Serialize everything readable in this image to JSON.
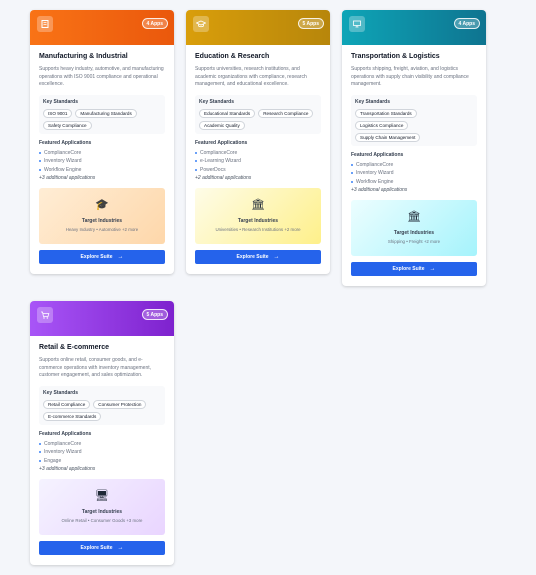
{
  "cards": [
    {
      "title": "Manufacturing & Industrial",
      "badge": "4 Apps",
      "description": "Supports heavy industry, automotive, and manufacturing operations with ISO 9001 compliance and operational excellence.",
      "standards_title": "Key Standards",
      "standards": [
        "ISO 9001",
        "Manufacturing Standards",
        "Safety Compliance"
      ],
      "apps_title": "Featured Applications",
      "apps": [
        "ComplianceCore",
        "Inventory Wizard",
        "Workflow Engine"
      ],
      "more": "+3 additional applications",
      "target_title": "Target Industries",
      "target_sub": "Heavy Industry • Automotive +2 more",
      "target_icon": "graduation-cap-icon",
      "button": "Explore Suite",
      "header_color": "#ea580c",
      "target_bg": "#ffedd5"
    },
    {
      "title": "Education & Research",
      "badge": "5 Apps",
      "description": "Supports universities, research institutions, and academic organizations with compliance, research management, and educational excellence.",
      "standards_title": "Key Standards",
      "standards": [
        "Educational Standards",
        "Research Compliance",
        "Academic Quality"
      ],
      "apps_title": "Featured Applications",
      "apps": [
        "ComplianceCore",
        "e-Learning Wizard",
        "PowerDocs"
      ],
      "more": "+2 additional applications",
      "target_title": "Target Industries",
      "target_sub": "Universities • Research Institutions +2 more",
      "target_icon": "institution-icon",
      "button": "Explore Suite",
      "header_color": "#ca8a04",
      "target_bg": "#fef9c3"
    },
    {
      "title": "Transportation & Logistics",
      "badge": "4 Apps",
      "description": "Supports shipping, freight, aviation, and logistics operations with supply chain visibility and compliance management.",
      "standards_title": "Key Standards",
      "standards": [
        "Transportation Standards",
        "Logistics Compliance",
        "Supply Chain Management"
      ],
      "apps_title": "Featured Applications",
      "apps": [
        "ComplianceCore",
        "Inventory Wizard",
        "Workflow Engine"
      ],
      "more": "+3 additional applications",
      "target_title": "Target Industries",
      "target_sub": "Shipping • Freight +2 more",
      "target_icon": "institution-icon",
      "button": "Explore Suite",
      "header_color": "#0891b2",
      "target_bg": "#cffafe"
    },
    {
      "title": "Retail & E-commerce",
      "badge": "5 Apps",
      "description": "Supports online retail, consumer goods, and e-commerce operations with inventory management, customer engagement, and sales optimization.",
      "standards_title": "Key Standards",
      "standards": [
        "Retail Compliance",
        "Consumer Protection",
        "E-commerce Standards"
      ],
      "apps_title": "Featured Applications",
      "apps": [
        "ComplianceCore",
        "Inventory Wizard",
        "Engage"
      ],
      "more": "+3 additional applications",
      "target_title": "Target Industries",
      "target_sub": "Online Retail • Consumer Goods +3 more",
      "target_icon": "computer-icon",
      "button": "Explore Suite",
      "header_color": "#9333ea",
      "target_bg": "#ede9fe"
    }
  ]
}
